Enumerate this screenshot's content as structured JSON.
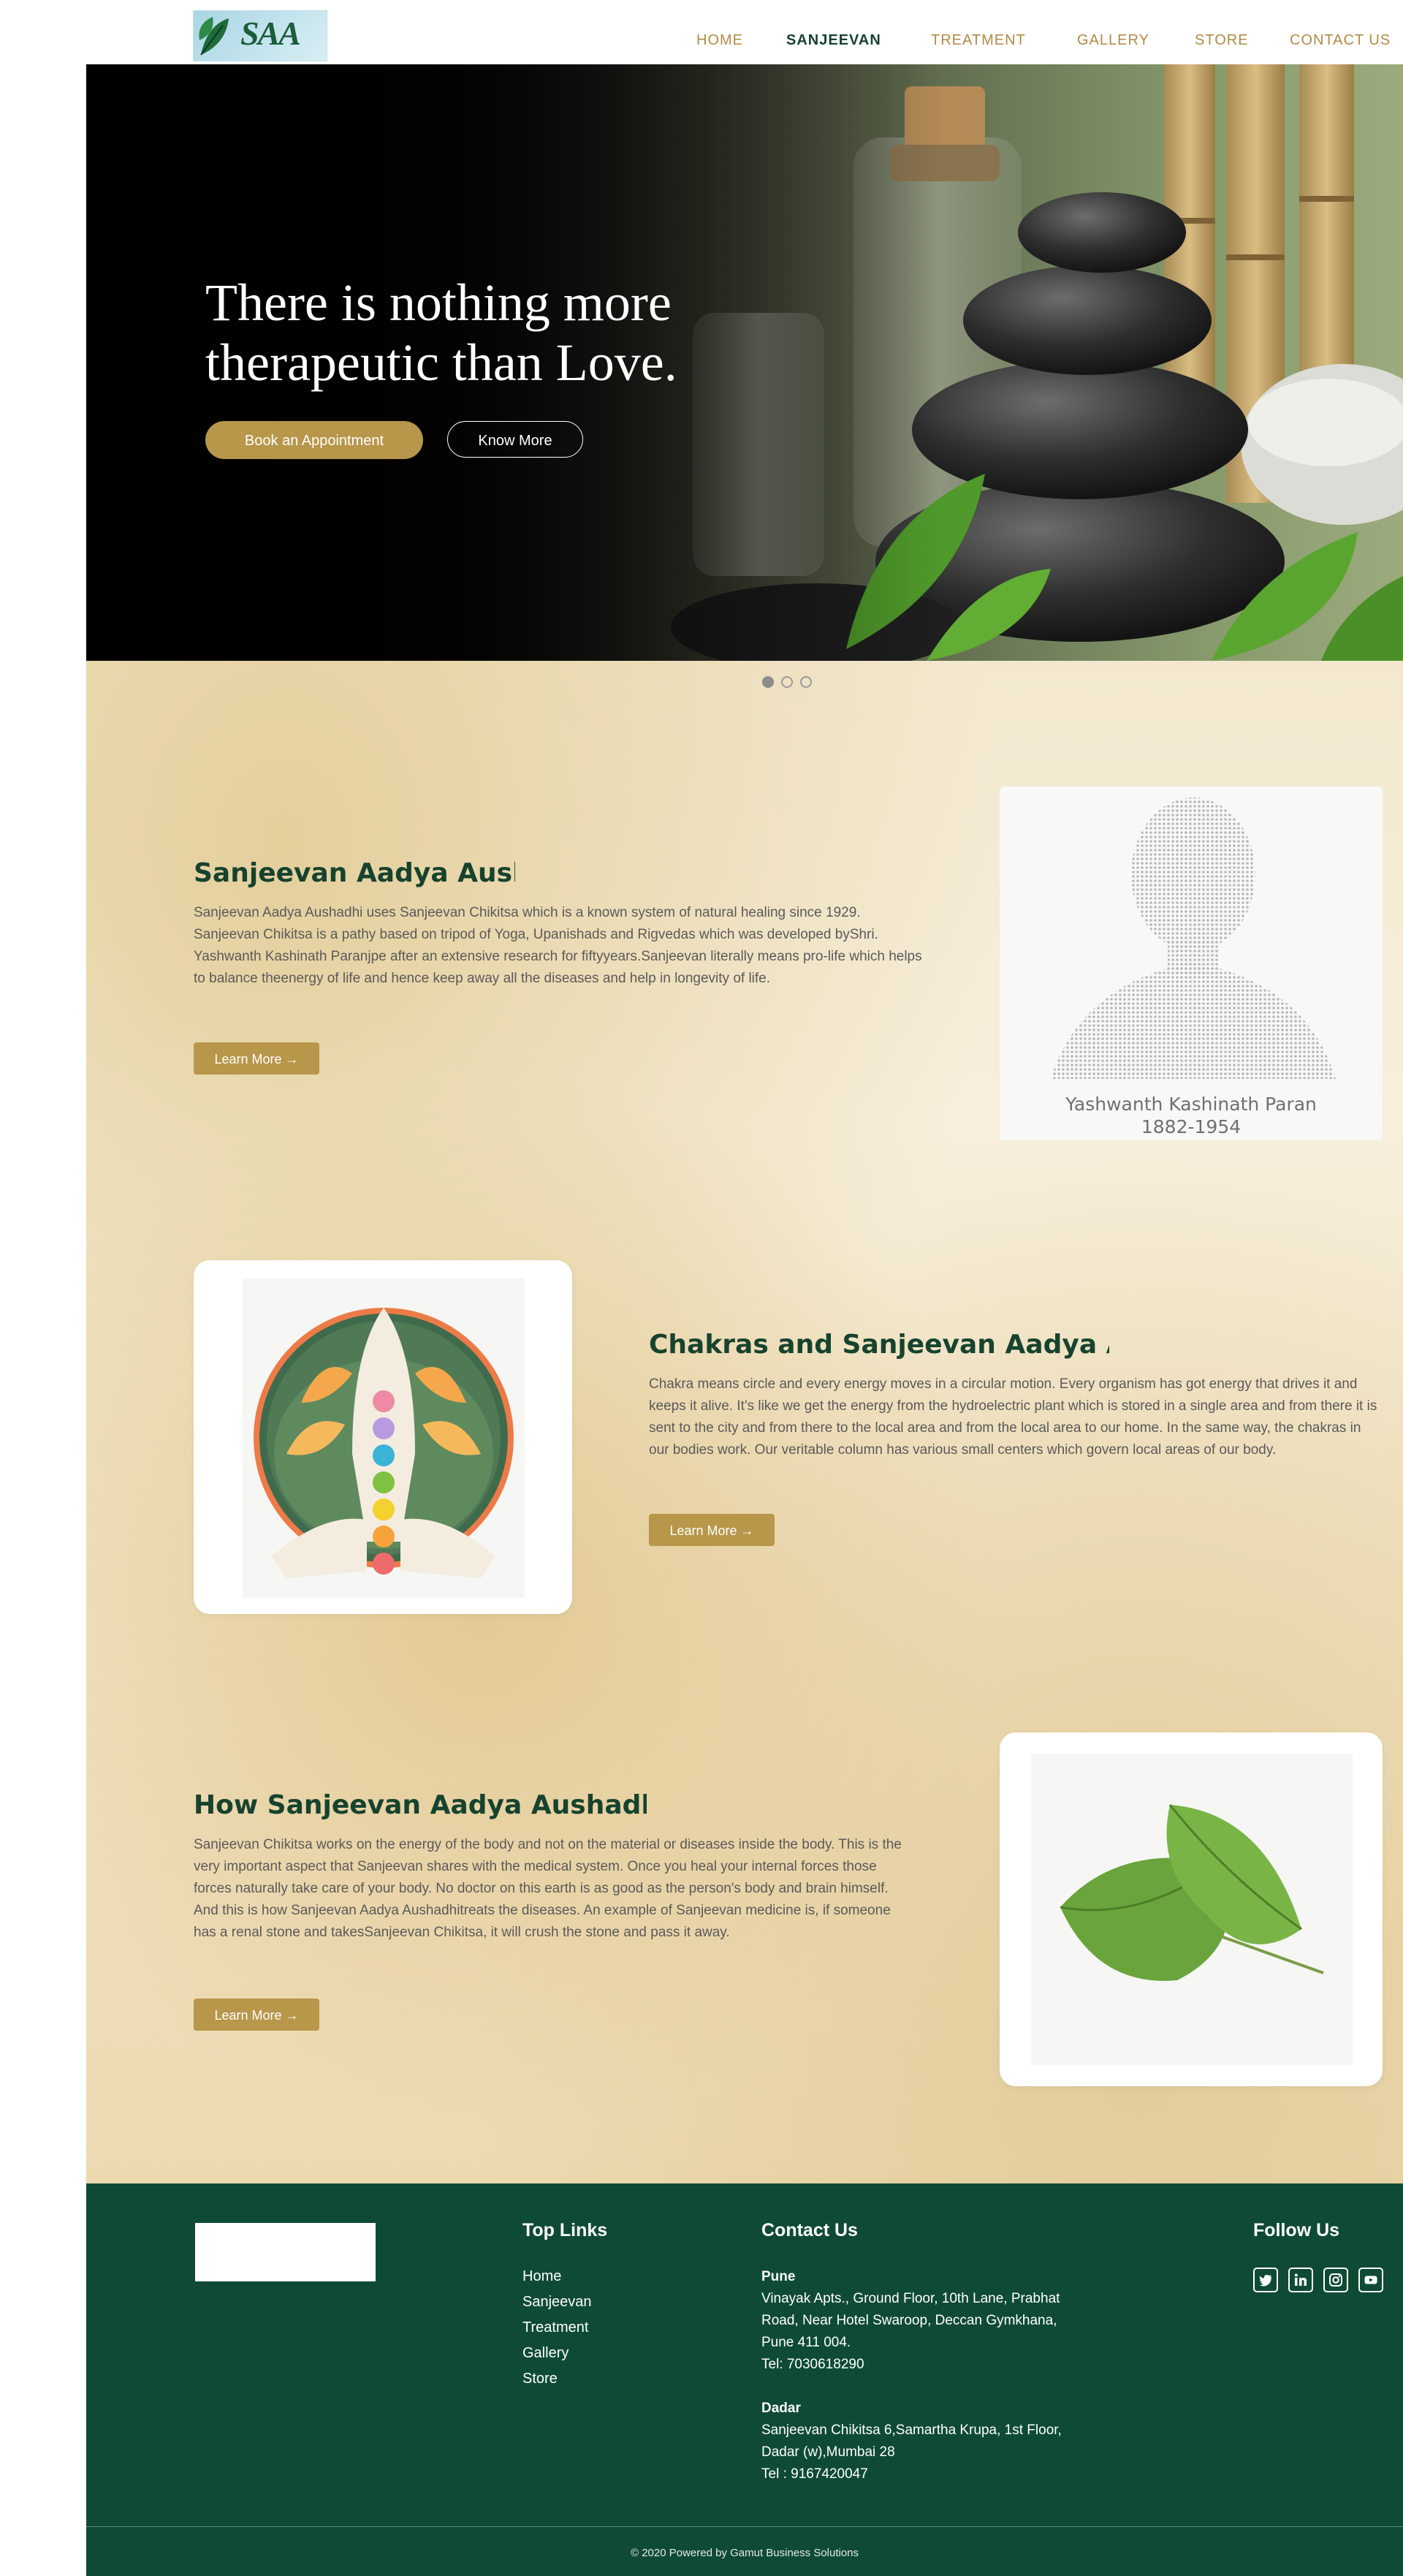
{
  "nav": {
    "logo_text": "SAA",
    "items": [
      {
        "label": "HOME"
      },
      {
        "label": "SANJEEVAN"
      },
      {
        "label": "TREATMENT"
      },
      {
        "label": "GALLERY"
      },
      {
        "label": "STORE"
      },
      {
        "label": "CONTACT US"
      }
    ],
    "active_index": 1
  },
  "hero": {
    "title": "There is nothing more therapeutic than Love.",
    "primary_button": "Book an Appointment",
    "secondary_button": "Know More",
    "slide_count": 3,
    "active_slide": 0
  },
  "sections": [
    {
      "title": "Sanjeevan Aadya Aushadh",
      "body": "Sanjeevan Aadya Aushadhi uses Sanjeevan Chikitsa which is a known system of natural healing since 1929. Sanjeevan Chikitsa is a pathy based on tripod of Yoga, Upanishads and Rigvedas which was developed byShri. Yashwanth Kashinath Paranjpe after an extensive research for fiftyyears.Sanjeevan literally means pro-life which helps to balance theenergy of life and hence keep away all the diseases and help in longevity of life.",
      "button": "Learn More →",
      "image_caption_name": "Yashwanth Kashinath Paran",
      "image_caption_years": "1882-1954"
    },
    {
      "title": "Chakras and Sanjeevan Aadya Aushadh",
      "body": "Chakra means circle and every energy moves in a circular motion. Every organism has got energy that drives it and keeps it alive. It's like we get the energy from the hydroelectric plant which is stored in a single area and from there it is sent to the city and from there to the local area and from the local area to our home. In the same way, the chakras in our bodies work. Our veritable column has various small centers which govern local areas of our body.",
      "button": "Learn More →"
    },
    {
      "title": "How Sanjeevan Aadya Aushadhi Work",
      "body": "Sanjeevan Chikitsa works on the energy of the body and not on the material or diseases inside the body. This is the very important aspect that Sanjeevan shares with the medical system. Once you heal your internal forces those forces naturally take care of your body. No doctor on this earth is as good as the person's body and brain himself. And this is how Sanjeevan Aadya Aushadhitreats the diseases. An example of Sanjeevan medicine is, if someone has a renal stone and takesSanjeevan Chikitsa, it will crush the stone and pass it away.",
      "button": "Learn More →"
    }
  ],
  "footer": {
    "top_links_title": "Top Links",
    "top_links": [
      "Home",
      "Sanjeevan",
      "Treatment",
      "Gallery",
      "Store"
    ],
    "contact_title": "Contact Us",
    "pune_label": "Pune",
    "pune_address_1": "Vinayak Apts., Ground Floor, 10th Lane, Prabhat",
    "pune_address_2": "Road, Near Hotel Swaroop,  Deccan Gymkhana,",
    "pune_address_3": "Pune 411 004.",
    "pune_tel": "Tel: 7030618290",
    "dadar_label": "Dadar",
    "dadar_address_1": "Sanjeevan Chikitsa 6,Samartha Krupa, 1st Floor,",
    "dadar_address_2": "Dadar (w),Mumbai 28",
    "dadar_tel": "Tel : 9167420047",
    "follow_title": "Follow Us",
    "social_icons": [
      "twitter-icon",
      "linkedin-icon",
      "instagram-icon",
      "youtube-icon"
    ],
    "copyright": "© 2020 Powered by Gamut Business Solutions"
  },
  "colors": {
    "brand_green": "#0f4b34",
    "gold": "#b8964a",
    "heading_green": "#16432e",
    "nav_gold": "#b28a44"
  }
}
